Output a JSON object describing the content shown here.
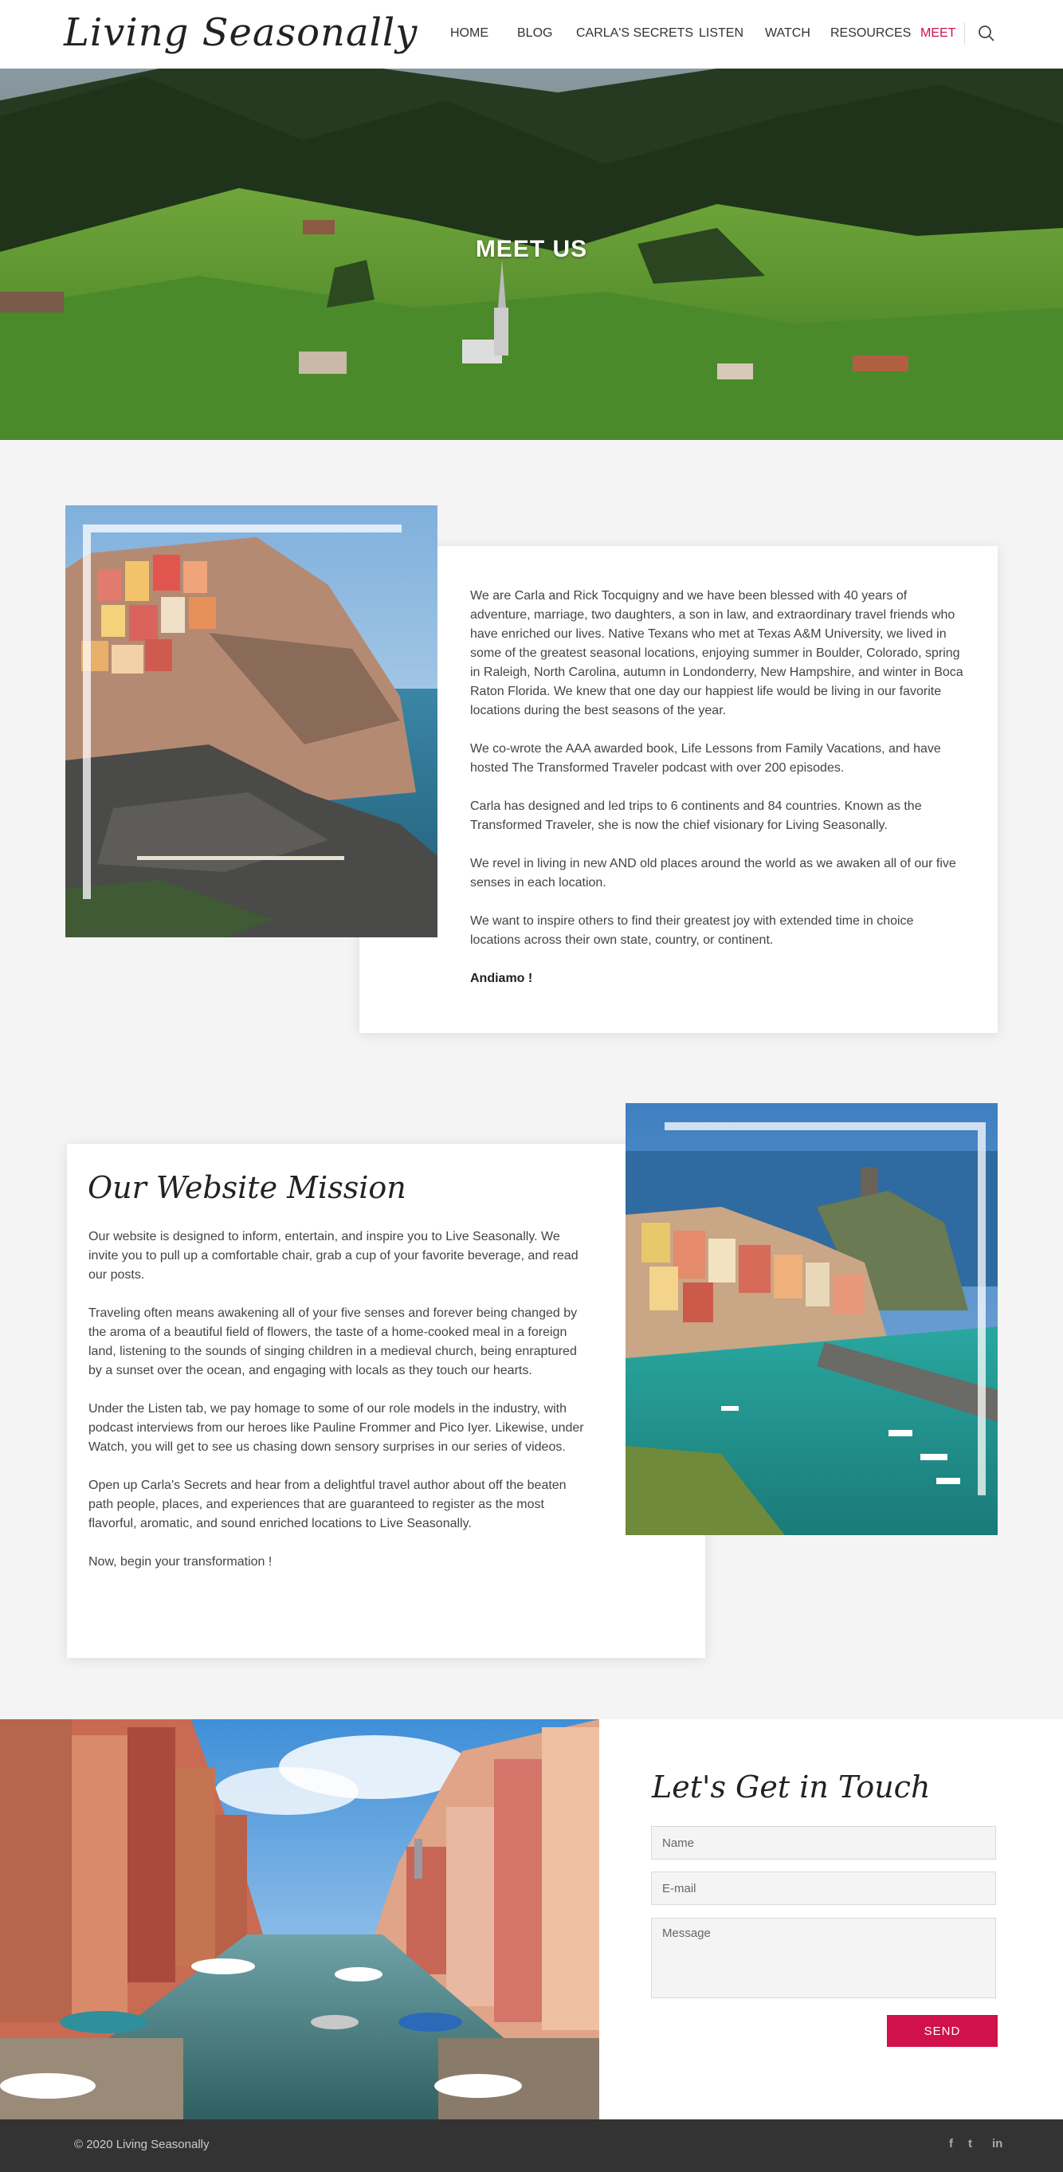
{
  "header": {
    "logo": "Living Seasonally",
    "nav": [
      "HOME",
      "BLOG",
      "CARLA'S SECRETS",
      "LISTEN",
      "WATCH",
      "RESOURCES",
      "MEET"
    ],
    "active_nav": "MEET",
    "search_icon": "search-icon"
  },
  "hero": {
    "title": "MEET US"
  },
  "about": {
    "paragraphs": [
      "We are Carla and Rick Tocquigny and we have been blessed with 40 years of adventure, marriage, two daughters, a son in law, and extraordinary travel friends who have enriched our lives. Native Texans who met at Texas A&M University, we lived in some of the greatest seasonal locations, enjoying summer in Boulder, Colorado, spring in Raleigh, North Carolina, autumn in Londonderry, New Hampshire, and winter in Boca Raton Florida. We knew that one day our happiest life would be living in our favorite locations during the best seasons of the year.",
      "We co-wrote the AAA awarded book, Life Lessons from Family Vacations, and have hosted The Transformed Traveler podcast with over 200 episodes.",
      "Carla has designed and led trips to 6 continents and 84 countries. Known as the Transformed Traveler, she is now the chief visionary for Living Seasonally.",
      "We revel in living in new AND old places around the world as we awaken all of our five senses in each location.",
      "We want to inspire others to find their greatest joy with extended time in choice locations across their own state, country, or continent."
    ],
    "signoff": "Andiamo !"
  },
  "mission": {
    "title": "Our Website Mission",
    "paragraphs": [
      "Our website is designed to inform, entertain, and inspire you to Live Seasonally. We invite you to pull up a comfortable chair, grab a cup of your favorite beverage, and read our posts.",
      "Traveling often means awakening all of your five senses and forever being changed by the aroma of a beautiful field of flowers, the taste of a home-cooked meal in a foreign land, listening to the sounds of singing children in a medieval church, being enraptured by a sunset over the ocean, and engaging with locals as they touch our hearts.",
      "Under the Listen tab, we pay homage to some of our role models in the industry, with podcast interviews from our heroes like Pauline Frommer and Pico Iyer. Likewise, under Watch, you will get to see us chasing down sensory surprises in our series of videos.",
      "Open up Carla's Secrets and hear from a delightful travel author about off the beaten path people, places, and experiences that are guaranteed to register as the most flavorful, aromatic, and sound enriched locations to Live Seasonally.",
      "Now, begin your transformation !"
    ]
  },
  "contact": {
    "title": "Let's Get in Touch",
    "name_placeholder": "Name",
    "email_placeholder": "E-mail",
    "message_placeholder": "Message",
    "send_label": "SEND"
  },
  "footer": {
    "copyright": "© 2020 Living Seasonally",
    "social": [
      {
        "icon": "facebook-icon",
        "glyph": "f"
      },
      {
        "icon": "twitter-icon",
        "glyph": "t"
      },
      {
        "icon": "linkedin-icon",
        "glyph": "in"
      }
    ]
  },
  "colors": {
    "accent": "#d0114a",
    "footer_bg": "#333333",
    "page_bg": "#f4f4f4"
  }
}
